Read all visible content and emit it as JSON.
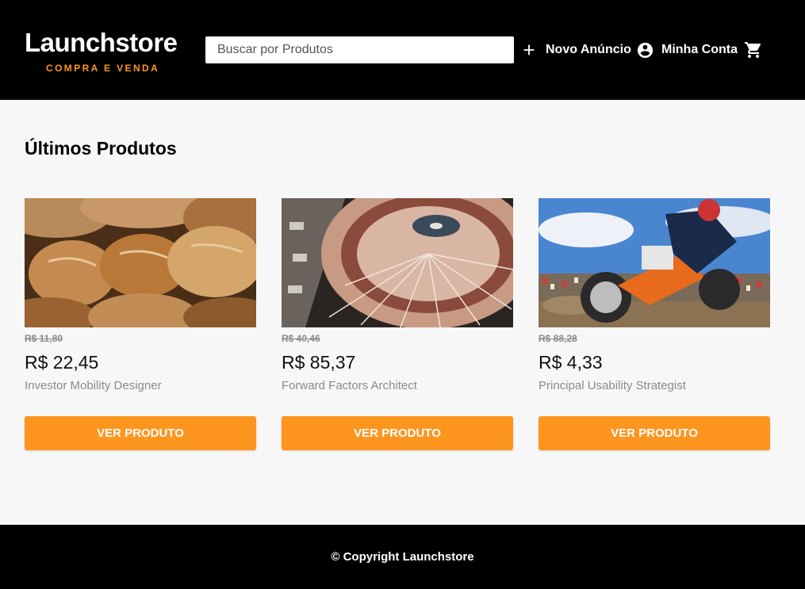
{
  "header": {
    "logo_title": "Launchstore",
    "logo_subtitle": "COMPRA E VENDA",
    "search_placeholder": "Buscar por Produtos",
    "nav": {
      "new_ad": {
        "label": "Novo Anúncio",
        "icon": "plus-icon"
      },
      "account": {
        "label": "Minha Conta",
        "icon": "account-circle-icon"
      },
      "cart": {
        "icon": "shopping-cart-icon"
      }
    }
  },
  "main": {
    "title": "Últimos Produtos",
    "products": [
      {
        "image": "bread-loaves-photo",
        "old_price": "R$ 11,80",
        "price": "R$ 22,45",
        "name": "Investor Mobility Designer",
        "button": "Ver Produto"
      },
      {
        "image": "turntable-photo",
        "old_price": "R$ 40,46",
        "price": "R$ 85,37",
        "name": "Forward Factors Architect",
        "button": "Ver Produto"
      },
      {
        "image": "motocross-photo",
        "old_price": "R$ 88,28",
        "price": "R$ 4,33",
        "name": "Principal Usability Strategist",
        "button": "Ver Produto"
      }
    ]
  },
  "footer": {
    "copyright": "© Copyright Launchstore"
  },
  "colors": {
    "accent": "#fd951f",
    "header_bg": "#000000",
    "page_bg": "#f7f7f7"
  }
}
